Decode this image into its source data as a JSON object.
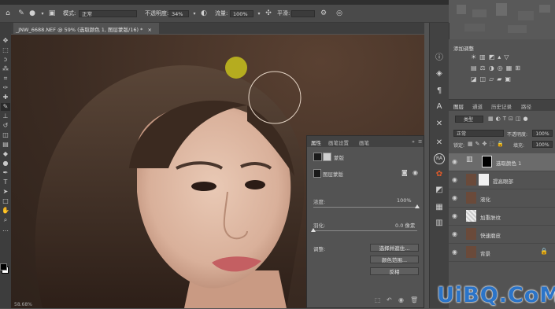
{
  "options_bar": {
    "mode_label": "模式:",
    "mode_value": "正常",
    "opacity_label": "不透明度:",
    "opacity_value": "34%",
    "flow_label": "流量:",
    "flow_value": "100%",
    "smoothing_label": "平滑:"
  },
  "document": {
    "tab_title": "_JNW_6688.NEF @ 59% (选取颜色 1, 图层蒙版/16) *",
    "close_glyph": "×"
  },
  "right_strip_icons": [
    "info-icon",
    "adjust-icon",
    "paragraph-icon",
    "character-icon",
    "tools-cross-icon",
    "tools-cross2-icon",
    "ra-badge",
    "plugin-icon",
    "color-icon",
    "swatch-icon",
    "grid-icon"
  ],
  "ra_label": "RA",
  "adjustments_panel": {
    "title": "添加调整"
  },
  "layers_panel": {
    "tabs": [
      "图层",
      "通道",
      "历史记录",
      "路径"
    ],
    "filter_value": "类型",
    "blend_mode": "正常",
    "opacity_label": "不透明度:",
    "opacity_value": "100%",
    "lock_label": "锁定:",
    "fill_label": "填充:",
    "fill_value": "100%",
    "layers": [
      {
        "name": "选取颜色 1",
        "selected": true
      },
      {
        "name": "提高眼部"
      },
      {
        "name": "液化"
      },
      {
        "name": "加重肤纹"
      },
      {
        "name": "快速磨皮"
      },
      {
        "name": "背景",
        "locked": true
      }
    ]
  },
  "properties_panel": {
    "tabs": [
      "属性",
      "画笔设置",
      "画笔"
    ],
    "section_title": "蒙版",
    "mask_label": "图层蒙版",
    "density_label": "浓度:",
    "density_value": "100%",
    "density_level": 1.0,
    "feather_label": "羽化:",
    "feather_value": "0.0 像素",
    "feather_level": 0.0,
    "refine_label": "调整:",
    "buttons": [
      "选择并遮住...",
      "颜色范围...",
      "反相"
    ]
  },
  "status": {
    "zoom": "58.68%"
  },
  "watermark": "UiBQ.CoM",
  "colors": {
    "panel_bg": "#535353",
    "dark_bar": "#424242",
    "brush_dot": "#b5ac1f",
    "brush_ring": "#e7d7c8",
    "watermark_blue": "#2b74c8"
  }
}
